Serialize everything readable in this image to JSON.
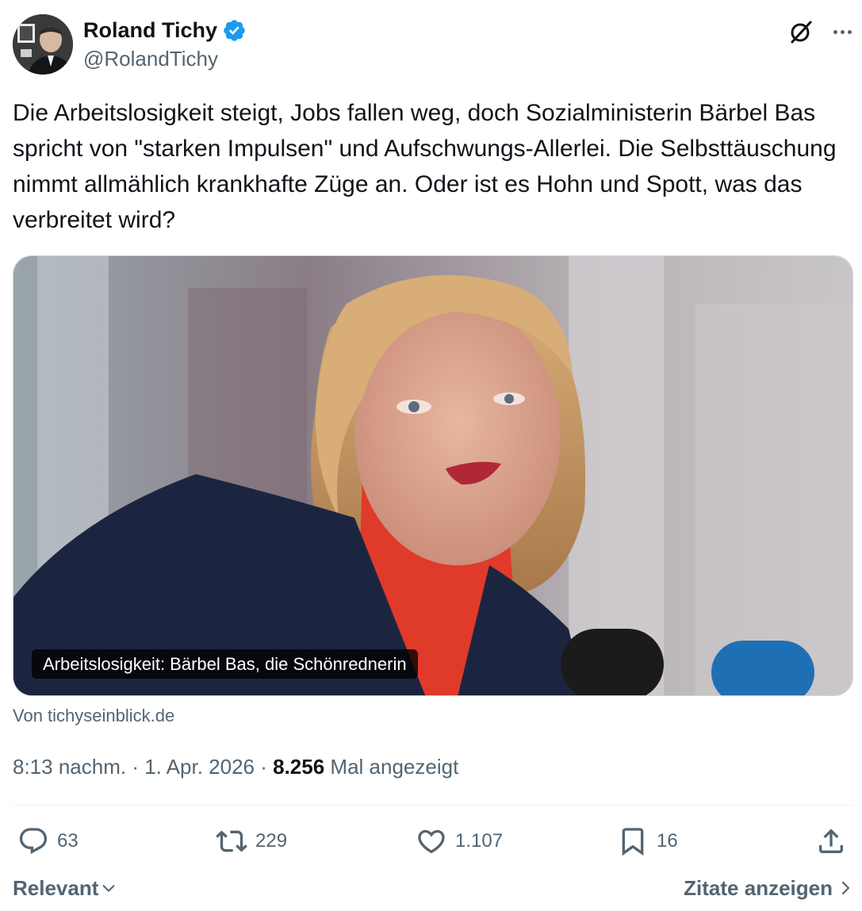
{
  "author": {
    "display_name": "Roland Tichy",
    "handle": "@RolandTichy",
    "verified": true,
    "verified_color": "#1d9bf0"
  },
  "tweet": {
    "text": "Die Arbeitslosigkeit steigt, Jobs fallen weg, doch Sozialministerin Bärbel Bas spricht von \"starken Impulsen\" und Aufschwungs-Allerlei. Die Selbsttäuschung nimmt allmählich krankhafte Züge an. Oder ist es Hohn und Spott, was das verbreitet wird?"
  },
  "card": {
    "caption": "Arbeitslosigkeit: Bärbel Bas, die Schönrednerin",
    "source": "Von tichyseinblick.de"
  },
  "meta": {
    "time": "8:13 nachm.",
    "separator": " · ",
    "date": "1. Apr. 2026",
    "views_count": "8.256",
    "views_label": "Mal angezeigt"
  },
  "actions": {
    "replies": "63",
    "reposts": "229",
    "likes": "1.107",
    "bookmarks": "16"
  },
  "footer": {
    "sort_label": "Relevant",
    "quotes_label": "Zitate anzeigen"
  },
  "icons": {
    "verified": "verified-badge-icon",
    "grok": "grok-icon",
    "more": "more-dots-icon",
    "reply": "reply-icon",
    "repost": "repost-icon",
    "like": "heart-icon",
    "bookmark": "bookmark-icon",
    "share": "share-icon",
    "sort": "chevron-down-icon",
    "quotes": "chevron-right-icon"
  },
  "colors": {
    "text_primary": "#0f1419",
    "text_secondary": "#536471",
    "divider": "#eff3f4"
  }
}
